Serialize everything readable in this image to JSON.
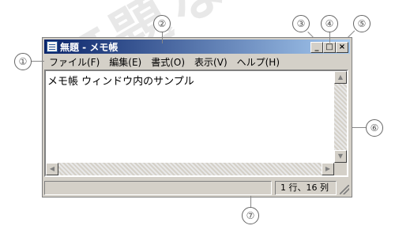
{
  "window": {
    "title": "無題 - メモ帳",
    "controls": {
      "minimize": "_",
      "maximize": "□",
      "close": "×"
    }
  },
  "menu": [
    "ファイル(F)",
    "編集(E)",
    "書式(O)",
    "表示(V)",
    "ヘルプ(H)"
  ],
  "editor": {
    "content": "メモ帳 ウィンドウ内のサンプル"
  },
  "scrollbar": {
    "up": "▲",
    "down": "▼",
    "left": "◀",
    "right": "▶"
  },
  "status": {
    "position": "1 行、16 列"
  },
  "callouts": [
    "①",
    "②",
    "③",
    "④",
    "⑤",
    "⑥",
    "⑦"
  ],
  "watermark": "無題な濃いロ"
}
